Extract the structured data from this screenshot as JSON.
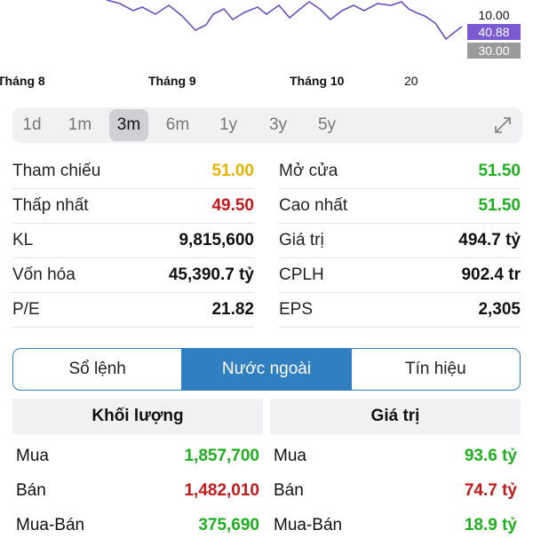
{
  "chart": {
    "axis_labels": [
      "10.00",
      "40.88",
      "30.00"
    ],
    "colors": {
      "line": "#6b4fbf",
      "badge_current": "#7a5ad0",
      "badge_low": "#9a9a9a"
    }
  },
  "months": [
    "Tháng 8",
    "Tháng 9",
    "Tháng 10",
    "20"
  ],
  "timeframes": {
    "options": [
      "1d",
      "1m",
      "3m",
      "6m",
      "1y",
      "3y",
      "5y"
    ],
    "active": "3m",
    "expand_icon": "expand-icon"
  },
  "stats": [
    {
      "left": {
        "label": "Tham chiếu",
        "value": "51.00",
        "color": "yellow"
      },
      "right": {
        "label": "Mở cửa",
        "value": "51.50",
        "color": "green"
      }
    },
    {
      "left": {
        "label": "Thấp nhất",
        "value": "49.50",
        "color": "red"
      },
      "right": {
        "label": "Cao nhất",
        "value": "51.50",
        "color": "green"
      }
    },
    {
      "left": {
        "label": "KL",
        "value": "9,815,600",
        "color": "black"
      },
      "right": {
        "label": "Giá trị",
        "value": "494.7 tỷ",
        "color": "black"
      }
    },
    {
      "left": {
        "label": "Vốn hóa",
        "value": "45,390.7 tỷ",
        "color": "black"
      },
      "right": {
        "label": "CPLH",
        "value": "902.4 tr",
        "color": "black"
      }
    },
    {
      "left": {
        "label": "P/E",
        "value": "21.82",
        "color": "black"
      },
      "right": {
        "label": "EPS",
        "value": "2,305",
        "color": "black"
      }
    }
  ],
  "tabs": {
    "items": [
      "Sổ lệnh",
      "Nước ngoài",
      "Tín hiệu"
    ],
    "active": "Nước ngoài"
  },
  "foreign": {
    "volume": {
      "header": "Khối lượng",
      "rows": [
        {
          "label": "Mua",
          "value": "1,857,700",
          "color": "green"
        },
        {
          "label": "Bán",
          "value": "1,482,010",
          "color": "red"
        },
        {
          "label": "Mua-Bán",
          "value": "375,690",
          "color": "green"
        }
      ]
    },
    "value": {
      "header": "Giá trị",
      "rows": [
        {
          "label": "Mua",
          "value": "93.6 tỷ",
          "color": "green"
        },
        {
          "label": "Bán",
          "value": "74.7 tỷ",
          "color": "red"
        },
        {
          "label": "Mua-Bán",
          "value": "18.9 tỷ",
          "color": "green"
        }
      ]
    }
  }
}
